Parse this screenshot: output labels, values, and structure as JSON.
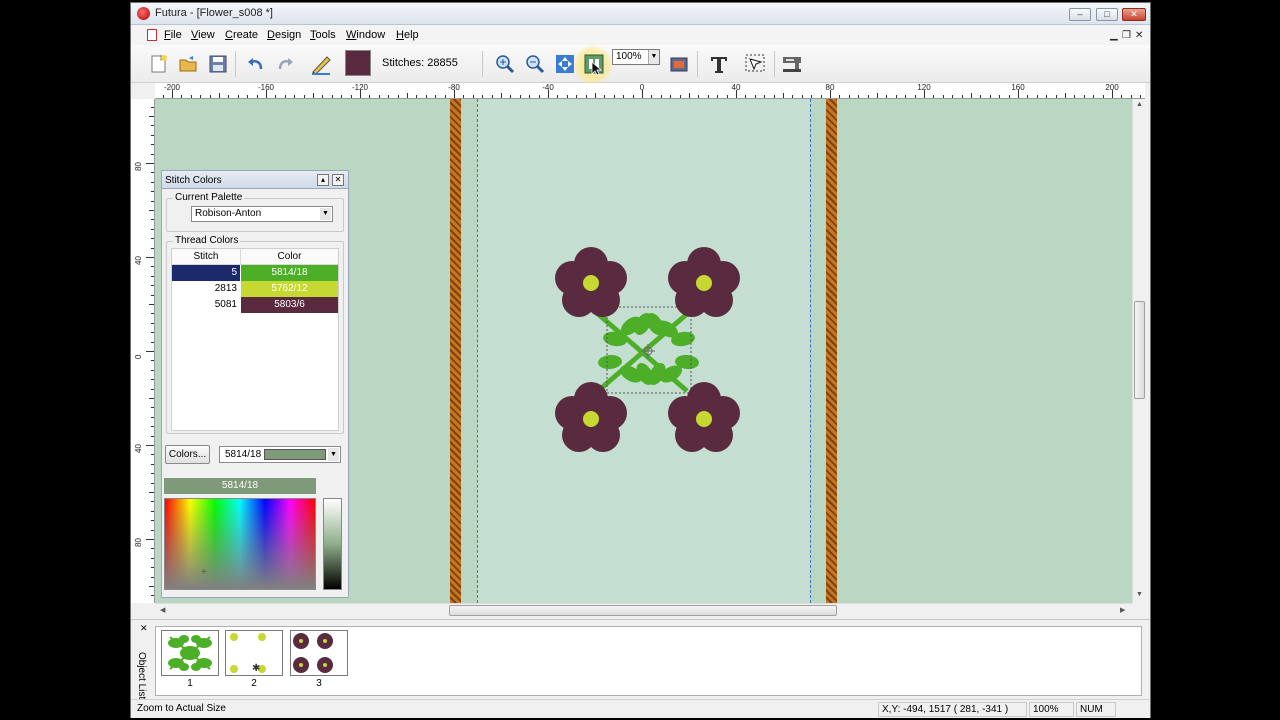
{
  "window": {
    "title": "Futura - [Flower_s008 *]"
  },
  "menu": {
    "items": [
      "File",
      "View",
      "Create",
      "Design",
      "Tools",
      "Window",
      "Help"
    ]
  },
  "toolbar": {
    "stitches_label": "Stitches: 28855",
    "zoom_value": "100%",
    "icons": [
      "new-file-icon",
      "open-folder-icon",
      "save-icon",
      "undo-icon",
      "redo-icon",
      "pen-icon",
      "zoom-in-icon",
      "zoom-out-icon",
      "zoom-to-fit-icon",
      "zoom-actual-size-icon",
      "stitch-simulator-icon",
      "text-icon",
      "select-icon",
      "embroidery-machine-icon"
    ],
    "current_color": "#5a2a3e"
  },
  "ruler": {
    "h_labels": [
      "-200",
      "-160",
      "-120",
      "-80",
      "-40",
      "0",
      "40",
      "80",
      "120",
      "160",
      "200"
    ],
    "v_labels": [
      "80",
      "40",
      "0",
      "40",
      "80"
    ]
  },
  "stitch_colors_panel": {
    "title": "Stitch Colors",
    "current_palette_label": "Current Palette",
    "palette_value": "Robison-Anton",
    "thread_colors_label": "Thread Colors",
    "columns": {
      "stitch": "Stitch",
      "color": "Color"
    },
    "rows": [
      {
        "stitch": "5",
        "color": "5814/18",
        "bg": "#4caf27",
        "selected": true
      },
      {
        "stitch": "2813",
        "color": "5762/12",
        "bg": "#c6d832",
        "selected": false
      },
      {
        "stitch": "5081",
        "color": "5803/6",
        "bg": "#5a2a3e",
        "selected": false
      }
    ],
    "colors_button": "Colors...",
    "color_select_value": "5814/18",
    "selected_color_label": "5814/18",
    "selected_color": "#7f9a78"
  },
  "object_list": {
    "label": "Object List",
    "items": [
      {
        "number": "1"
      },
      {
        "number": "2"
      },
      {
        "number": "3"
      }
    ]
  },
  "statusbar": {
    "message": "Zoom to Actual Size",
    "coords": "X,Y: -494, 1517  ( 281, -341 )",
    "zoom": "100%",
    "num": "NUM"
  },
  "colors": {
    "canvas": "#b9d7c3",
    "flower": "#5a2a3e",
    "flower_center": "#c6d832",
    "leaves": "#4caf27",
    "border_stripe": "#c9741f"
  }
}
